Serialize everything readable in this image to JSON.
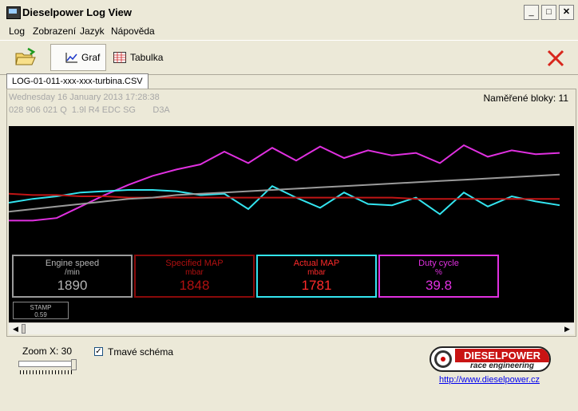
{
  "window": {
    "title": "Dieselpower Log View"
  },
  "menu": [
    "Log",
    "Zobrazení",
    "Jazyk",
    "Nápověda"
  ],
  "toolbar": {
    "graph_label": "Graf",
    "table_label": "Tabulka"
  },
  "document_tab": "LOG-01-011-xxx-xxx-turbina.CSV",
  "info": {
    "date": "Wednesday 16 January 2013 17:28:38",
    "vehicle": "028 906 021 Q  1.9l R4 EDC SG       D3A",
    "blocks": "Naměřené bloky: 11"
  },
  "gauges": [
    {
      "name": "Engine speed",
      "unit": "/min",
      "value": "1890",
      "color": "#9a9a9a",
      "text_color": "#b4b4b4"
    },
    {
      "name": "Specified MAP",
      "unit": "mbar",
      "value": "1848",
      "color": "#8a0a0a",
      "text_color": "#b01010"
    },
    {
      "name": "Actual MAP",
      "unit": "mbar",
      "value": "1781",
      "color": "#33e5f0",
      "text_color": "#ff2a2a"
    },
    {
      "name": "Duty cycle",
      "unit": "%",
      "value": "39.8",
      "color": "#e030e0",
      "text_color": "#e030e0"
    }
  ],
  "stamp": {
    "label": "STAMP",
    "value": "0.59"
  },
  "bottom": {
    "zoom": "Zoom X: 30",
    "zoom_level": 30,
    "dark_scheme_label": "Tmavé schéma",
    "dark_scheme_checked": true,
    "logo_title": "DIESELPOWER",
    "logo_sub": "race engineering",
    "website": "http://www.dieselpower.cz"
  },
  "chart_data": {
    "type": "line",
    "series": [
      {
        "name": "Duty cycle",
        "color": "#e030e0",
        "values": [
          26,
          26,
          28,
          37,
          46,
          54,
          61,
          66,
          70,
          80,
          71,
          83,
          73,
          84,
          75,
          81,
          77,
          79,
          71,
          85,
          76,
          81,
          78,
          79
        ]
      },
      {
        "name": "Actual MAP",
        "color": "#33e5f0",
        "values": [
          40,
          43,
          45,
          48,
          49,
          50,
          50,
          49,
          46,
          47,
          35,
          53,
          44,
          36,
          48,
          39,
          38,
          44,
          31,
          48,
          37,
          45,
          41,
          38
        ]
      },
      {
        "name": "Specified MAP",
        "color": "#c01515",
        "values": [
          47,
          46,
          46,
          45,
          45,
          44,
          44,
          44,
          44,
          44,
          44,
          44,
          44,
          44,
          44,
          44,
          44,
          43,
          43,
          43,
          43,
          43,
          43,
          43
        ]
      },
      {
        "name": "Engine speed",
        "color": "#9a9a9a",
        "values": [
          33,
          35,
          37,
          39,
          41,
          43,
          44,
          46,
          47,
          48,
          49,
          50,
          51,
          52,
          53,
          54,
          55,
          56,
          57,
          58,
          59,
          60,
          61,
          62
        ]
      }
    ]
  }
}
